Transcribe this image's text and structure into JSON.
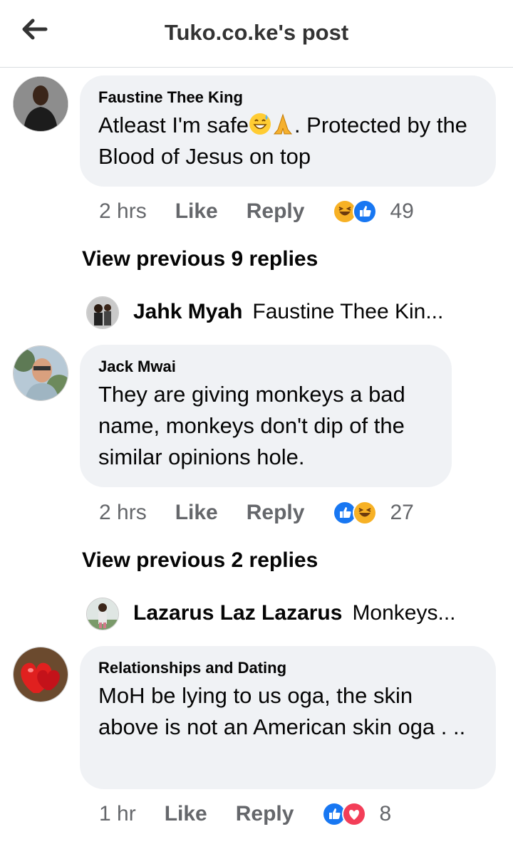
{
  "header": {
    "title": "Tuko.co.ke's post",
    "back_icon": "arrow-left-icon"
  },
  "comments": [
    {
      "author": "Faustine Thee King",
      "text_a": "Atleast I'm safe",
      "text_b": ". Protected by the Blood of Jesus on top",
      "time": "2 hrs",
      "like": "Like",
      "reply": "Reply",
      "reactions": [
        "haha",
        "like"
      ],
      "count": "49",
      "view_previous": "View previous 9 replies",
      "reply_preview": {
        "name": "Jahk Myah",
        "snippet": "Faustine Thee Kin..."
      }
    },
    {
      "author": "Jack Mwai",
      "text": "They are giving monkeys a bad name, monkeys don't dip of the similar opinions hole.",
      "time": "2 hrs",
      "like": "Like",
      "reply": "Reply",
      "reactions": [
        "like",
        "haha"
      ],
      "count": "27",
      "view_previous": "View previous 2 replies",
      "reply_preview": {
        "name": "Lazarus Laz Lazarus",
        "snippet": "Monkeys..."
      }
    },
    {
      "author": "Relationships and Dating",
      "text": "MoH be lying to us oga, the skin above is not an American skin oga . ..",
      "time": "1 hr",
      "like": "Like",
      "reply": "Reply",
      "reactions": [
        "like",
        "love"
      ],
      "count": "8"
    }
  ],
  "colors": {
    "like": "#1877f2",
    "love": "#f33e58",
    "haha": "#f7b125",
    "bubble": "#f0f2f5",
    "meta": "#65676b"
  }
}
